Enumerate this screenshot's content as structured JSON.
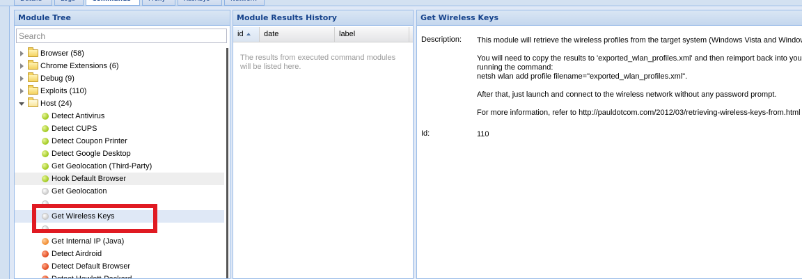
{
  "top_tabs": [
    "Details",
    "Logs",
    "Commands",
    "Proxy",
    "XssRays",
    "Network"
  ],
  "active_tab": "Commands",
  "tree_panel": {
    "title": "Module Tree",
    "search_placeholder": "Search",
    "nodes": [
      {
        "label": "Browser (58)",
        "kind": "folder",
        "expanded": false
      },
      {
        "label": "Chrome Extensions (6)",
        "kind": "folder",
        "expanded": false
      },
      {
        "label": "Debug (9)",
        "kind": "folder",
        "expanded": false
      },
      {
        "label": "Exploits (110)",
        "kind": "folder",
        "expanded": false
      },
      {
        "label": "Host (24)",
        "kind": "folder",
        "expanded": true
      },
      {
        "label": "Detect Antivirus",
        "kind": "module",
        "status": "green"
      },
      {
        "label": "Detect CUPS",
        "kind": "module",
        "status": "green"
      },
      {
        "label": "Detect Coupon Printer",
        "kind": "module",
        "status": "green"
      },
      {
        "label": "Detect Google Desktop",
        "kind": "module",
        "status": "green"
      },
      {
        "label": "Get Geolocation (Third-Party)",
        "kind": "module",
        "status": "green"
      },
      {
        "label": "Hook Default Browser",
        "kind": "module",
        "status": "green"
      },
      {
        "label": "Get Geolocation",
        "kind": "module",
        "status": "grey"
      },
      {
        "label": "",
        "kind": "module",
        "status": "grey"
      },
      {
        "label": "Get Wireless Keys",
        "kind": "module",
        "status": "grey"
      },
      {
        "label": "",
        "kind": "module",
        "status": "grey"
      },
      {
        "label": "Get Internal IP (Java)",
        "kind": "module",
        "status": "orange"
      },
      {
        "label": "Detect Airdroid",
        "kind": "module",
        "status": "red"
      },
      {
        "label": "Detect Default Browser",
        "kind": "module",
        "status": "red"
      },
      {
        "label": "Detect Hewlett-Packard",
        "kind": "module",
        "status": "red"
      }
    ]
  },
  "results_panel": {
    "title": "Module Results History",
    "columns": [
      "id",
      "date",
      "label"
    ],
    "empty_text": "The results from executed command modules will be listed here."
  },
  "detail_panel": {
    "title": "Get Wireless Keys",
    "description_label": "Description:",
    "description_lines": [
      "This module will retrieve the wireless profiles from the target system (Windows Vista and Window",
      "",
      "You will need to copy the results to 'exported_wlan_profiles.xml' and then reimport back into your",
      "running the command:",
      "netsh wlan add profile filename=\"exported_wlan_profiles.xml\".",
      "",
      "After that, just launch and connect to the wireless network without any password prompt.",
      "",
      "For more information, refer to http://pauldotcom.com/2012/03/retrieving-wireless-keys-from.html"
    ],
    "id_label": "Id:",
    "id_value": "110"
  },
  "colors": {
    "header_text": "#15428b",
    "panel_border": "#99bbe8",
    "highlight": "#e01a22"
  }
}
